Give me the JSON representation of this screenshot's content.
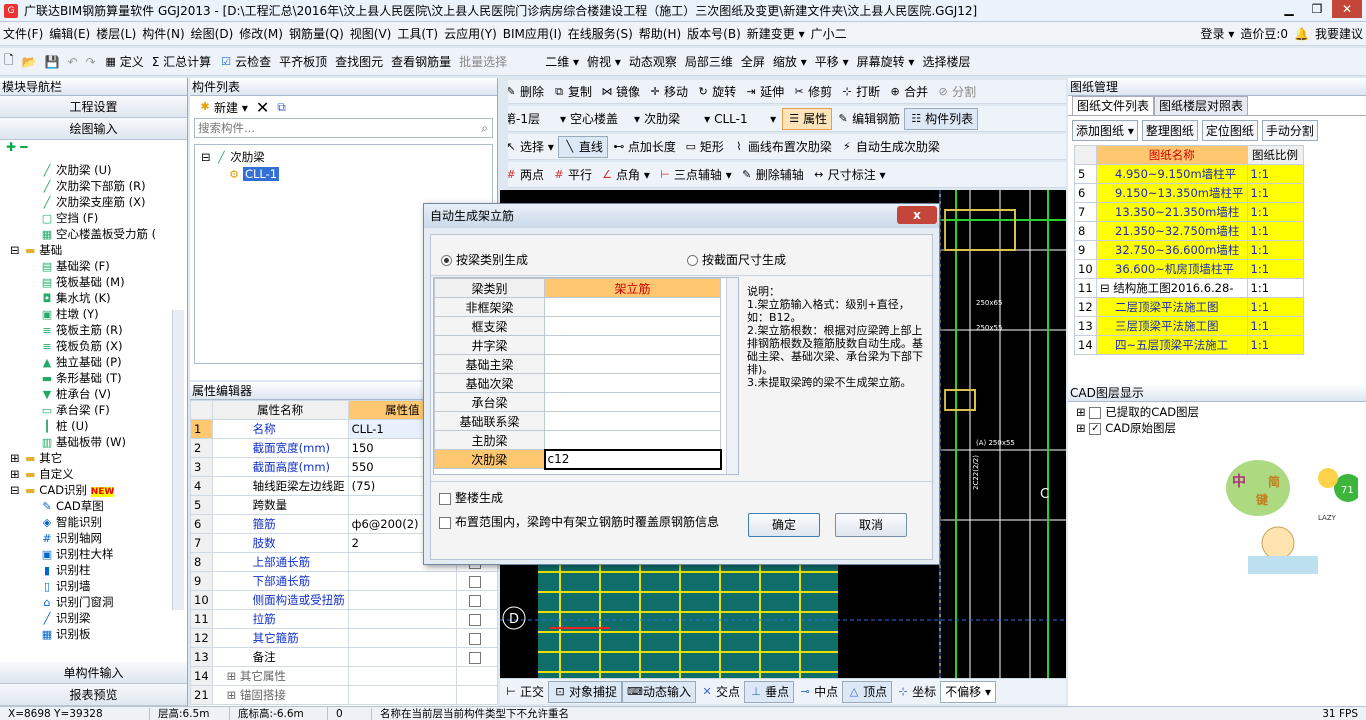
{
  "window": {
    "title": "广联达BIM钢筋算量软件 GGJ2013 - [D:\\工程汇总\\2016年\\汶上县人民医院\\汶上县人民医院门诊病房综合楼建设工程（施工）三次图纸及变更\\新建文件夹\\汶上县人民医院.GGJ12]"
  },
  "menu": [
    "文件(F)",
    "编辑(E)",
    "楼层(L)",
    "构件(N)",
    "绘图(D)",
    "修改(M)",
    "钢筋量(Q)",
    "视图(V)",
    "工具(T)",
    "云应用(Y)",
    "BIM应用(I)",
    "在线服务(S)",
    "帮助(H)",
    "版本号(B)",
    "新建变更 ▾",
    "广小二"
  ],
  "menu_right": {
    "login": "登录 ▾",
    "points": "造价豆:0",
    "suggest": "我要建议"
  },
  "toolbar1": [
    "定义",
    "Σ 汇总计算",
    "云检查",
    "平齐板顶",
    "查找图元",
    "查看钢筋量",
    "批量选择",
    "二维 ▾",
    "俯视 ▾",
    "动态观察",
    "局部三维",
    "全屏",
    "缩放 ▾",
    "平移 ▾",
    "屏幕旋转 ▾",
    "选择楼层"
  ],
  "toolbar2": [
    "删除",
    "复制",
    "镜像",
    "移动",
    "旋转",
    "延伸",
    "修剪",
    "打断",
    "合并",
    "分割"
  ],
  "toolbar3": {
    "floor": "第-1层",
    "type": "空心楼盖",
    "sub": "次肋梁",
    "item": "CLL-1",
    "props": "属性",
    "edit": "编辑钢筋",
    "list": "构件列表"
  },
  "toolbar4": [
    "选择 ▾",
    "直线",
    "点加长度",
    "矩形",
    "画线布置次肋梁",
    "自动生成次肋梁"
  ],
  "toolbar5": [
    "两点",
    "平行",
    "点角 ▾",
    "三点辅轴 ▾",
    "删除辅轴",
    "尺寸标注 ▾"
  ],
  "left_panel": {
    "title": "模块导航栏",
    "btn1": "工程设置",
    "btn2": "绘图输入",
    "tree": [
      "次肋梁 (U)",
      "次肋梁下部筋 (R)",
      "次肋梁支座筋 (X)",
      "空挡 (F)",
      "空心楼盖板受力筋 (",
      "基础",
      "基础梁 (F)",
      "筏板基础 (M)",
      "集水坑 (K)",
      "柱墩 (Y)",
      "筏板主筋 (R)",
      "筏板负筋 (X)",
      "独立基础 (P)",
      "条形基础 (T)",
      "桩承台 (V)",
      "承台梁 (F)",
      "桩 (U)",
      "基础板带 (W)",
      "其它",
      "自定义",
      "CAD识别",
      "CAD草图",
      "智能识别",
      "识别轴网",
      "识别柱大样",
      "识别柱",
      "识别墙",
      "识别门窗洞",
      "识别梁",
      "识别板"
    ],
    "new_badge": "NEW",
    "bottom1": "单构件输入",
    "bottom2": "报表预览"
  },
  "component_list": {
    "title": "构件列表",
    "new_btn": "新建 ▾",
    "search_placeholder": "搜索构件...",
    "root": "次肋梁",
    "child": "CLL-1"
  },
  "property_editor": {
    "title": "属性编辑器",
    "col_name": "属性名称",
    "col_value": "属性值",
    "rows": [
      {
        "n": "1",
        "name": "名称",
        "value": "CLL-1"
      },
      {
        "n": "2",
        "name": "截面宽度(mm)",
        "value": "150"
      },
      {
        "n": "3",
        "name": "截面高度(mm)",
        "value": "550"
      },
      {
        "n": "4",
        "name": "轴线距梁左边线距",
        "value": "(75)"
      },
      {
        "n": "5",
        "name": "跨数量",
        "value": ""
      },
      {
        "n": "6",
        "name": "箍筋",
        "value": "ф6@200(2)"
      },
      {
        "n": "7",
        "name": "肢数",
        "value": "2"
      },
      {
        "n": "8",
        "name": "上部通长筋",
        "value": ""
      },
      {
        "n": "9",
        "name": "下部通长筋",
        "value": ""
      },
      {
        "n": "10",
        "name": "侧面构造或受扭筋",
        "value": ""
      },
      {
        "n": "11",
        "name": "拉筋",
        "value": ""
      },
      {
        "n": "12",
        "name": "其它箍筋",
        "value": ""
      },
      {
        "n": "13",
        "name": "备注",
        "value": ""
      },
      {
        "n": "14",
        "name": "⊞ 其它属性",
        "value": ""
      },
      {
        "n": "21",
        "name": "⊞ 锚固搭接",
        "value": ""
      }
    ]
  },
  "drawing_mgmt": {
    "title": "图纸管理",
    "tab1": "图纸文件列表",
    "tab2": "图纸楼层对照表",
    "btns": [
      "添加图纸 ▾",
      "整理图纸",
      "定位图纸",
      "手动分割"
    ],
    "col_name": "图纸名称",
    "col_ratio": "图纸比例",
    "rows": [
      {
        "n": "5",
        "name": "4.950~9.150m墙柱平",
        "ratio": "1:1"
      },
      {
        "n": "6",
        "name": "9.150~13.350m墙柱平",
        "ratio": "1:1"
      },
      {
        "n": "7",
        "name": "13.350~21.350m墙柱",
        "ratio": "1:1"
      },
      {
        "n": "8",
        "name": "21.350~32.750m墙柱",
        "ratio": "1:1"
      },
      {
        "n": "9",
        "name": "32.750~36.600m墙柱",
        "ratio": "1:1"
      },
      {
        "n": "10",
        "name": "36.600~机房顶墙柱平",
        "ratio": "1:1"
      },
      {
        "n": "11",
        "name": "⊟ 结构施工图2016.6.28-",
        "ratio": "1:1"
      },
      {
        "n": "12",
        "name": "二层顶梁平法施工图",
        "ratio": "1:1"
      },
      {
        "n": "13",
        "name": "三层顶梁平法施工图",
        "ratio": "1:1"
      },
      {
        "n": "14",
        "name": "四~五层顶梁平法施工",
        "ratio": "1:1"
      }
    ]
  },
  "cad_layers": {
    "title": "CAD图层显示",
    "l1": "已提取的CAD图层",
    "l2": "CAD原始图层"
  },
  "dialog": {
    "title": "自动生成架立筋",
    "opt1": "按梁类别生成",
    "opt2": "按截面尺寸生成",
    "col1": "梁类别",
    "col2": "架立筋",
    "rows": [
      {
        "cat": "非框架梁",
        "val": ""
      },
      {
        "cat": "框支梁",
        "val": ""
      },
      {
        "cat": "井字梁",
        "val": ""
      },
      {
        "cat": "基础主梁",
        "val": ""
      },
      {
        "cat": "基础次梁",
        "val": ""
      },
      {
        "cat": "承台梁",
        "val": ""
      },
      {
        "cat": "基础联系梁",
        "val": ""
      },
      {
        "cat": "主肋梁",
        "val": ""
      },
      {
        "cat": "次肋梁",
        "val": "c12"
      }
    ],
    "note_title": "说明：",
    "note1": "1.架立筋输入格式：级别+直径，如：B12。",
    "note2": "2.架立筋根数：根据对应梁跨上部上排钢筋根数及箍筋肢数自动生成。基础主梁、基础次梁、承台梁为下部下排)。",
    "note3": "3.未提取梁跨的梁不生成架立筋。",
    "chk1": "整楼生成",
    "chk2": "布置范围内，梁跨中有架立钢筋时覆盖原钢筋信息",
    "ok": "确定",
    "cancel": "取消",
    "close": "x"
  },
  "bottom_toolbar": [
    "正交",
    "对象捕捉",
    "动态输入",
    "交点",
    "垂点",
    "中点",
    "顶点",
    "坐标",
    "不偏移 ▾"
  ],
  "status": [
    "X=8698 Y=39328",
    "层高:6.5m",
    "底标高:-6.6m",
    "0",
    "名称在当前层当前构件类型下不允许重名",
    "31 FPS"
  ],
  "cad_labels": {
    "axis_c": "C",
    "axis_d": "D",
    "seventyone": "71"
  },
  "mascot": {
    "text1": "中",
    "text2": "键",
    "text3": "简",
    "lazy": "LAZY"
  }
}
